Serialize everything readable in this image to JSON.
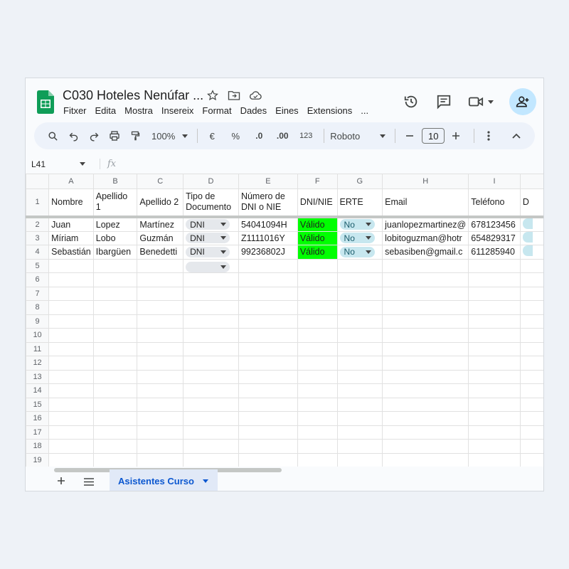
{
  "doc": {
    "title": "C030 Hoteles Nenúfar ...",
    "menu": [
      "Fitxer",
      "Edita",
      "Mostra",
      "Insereix",
      "Format",
      "Dades",
      "Eines",
      "Extensions",
      "..."
    ]
  },
  "toolbar": {
    "zoom": "100%",
    "currency": "€",
    "percent": "%",
    "dec_decrease": ".0",
    "dec_increase": ".00",
    "format_123": "123",
    "font": "Roboto",
    "font_size": "10"
  },
  "formula_bar": {
    "cell_ref": "L41",
    "fx": "fx"
  },
  "grid": {
    "columns": [
      "A",
      "B",
      "C",
      "D",
      "E",
      "F",
      "G",
      "H",
      "I",
      ""
    ],
    "header_row": {
      "num": "1",
      "cells": [
        "Nombre",
        "Apellido 1",
        "Apellido 2",
        "Tipo de Documento",
        "Número de DNI o NIE",
        "DNI/NIE",
        "ERTE",
        "Email",
        "Teléfono",
        "D"
      ]
    },
    "rows": [
      {
        "num": "2",
        "nombre": "Juan",
        "ap1": "Lopez",
        "ap2": "Martínez",
        "tipo": "DNI",
        "dni": "54041094H",
        "estado": "Válido",
        "erte": "No",
        "email": "juanlopezmartinez@",
        "tel": "678123456"
      },
      {
        "num": "3",
        "nombre": "Míriam",
        "ap1": "Lobo",
        "ap2": "Guzmán",
        "tipo": "DNI",
        "dni": "Z1111016Y",
        "estado": "Válido",
        "erte": "No",
        "email": "lobitoguzman@hotr",
        "tel": "654829317"
      },
      {
        "num": "4",
        "nombre": "Sebastián",
        "ap1": "Ibargüen",
        "ap2": "Benedetti",
        "tipo": "DNI",
        "dni": "99236802J",
        "estado": "Válido",
        "erte": "No",
        "email": "sebasiben@gmail.c",
        "tel": "611285940"
      }
    ],
    "empty_rows": [
      "5",
      "6",
      "7",
      "8",
      "9",
      "10",
      "11",
      "12",
      "13",
      "14",
      "15",
      "16",
      "17",
      "18",
      "19"
    ]
  },
  "sheet_tab": "Asistentes Curso",
  "colors": {
    "valid_fill": "#00ff00",
    "chip_blue": "#c7e7ef",
    "accent": "#0b57d0"
  }
}
